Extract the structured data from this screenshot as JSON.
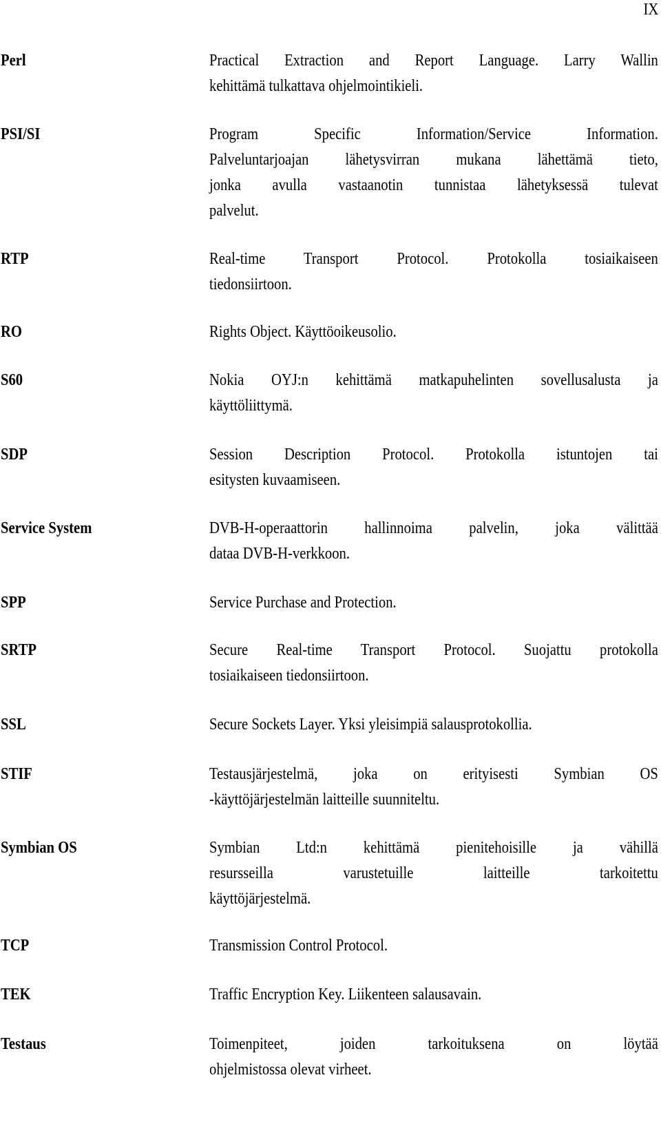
{
  "page": {
    "number": "IX"
  },
  "glossary": {
    "entries": [
      {
        "term": "Perl",
        "lines": [
          "Practical Extraction and Report Language. Larry Wallin",
          "kehittämä tulkattava ohjelmointikieli."
        ]
      },
      {
        "term": "PSI/SI",
        "lines": [
          "Program Specific Information/Service Information.",
          "Palveluntarjoajan lähetysvirran mukana lähettämä tieto,",
          "jonka avulla vastaanotin tunnistaa lähetyksessä tulevat",
          "palvelut."
        ]
      },
      {
        "term": "RTP",
        "lines": [
          "Real-time Transport Protocol. Protokolla tosiaikaiseen",
          "tiedonsiirtoon."
        ]
      },
      {
        "term": "RO",
        "lines": [
          "Rights Object. Käyttöoikeusolio."
        ]
      },
      {
        "term": "S60",
        "lines": [
          "Nokia OYJ:n kehittämä matkapuhelinten sovellusalusta ja",
          "käyttöliittymä."
        ]
      },
      {
        "term": "SDP",
        "lines": [
          "Session Description Protocol. Protokolla istuntojen tai",
          "esitysten kuvaamiseen."
        ]
      },
      {
        "term": "Service System",
        "lines": [
          "DVB-H-operaattorin hallinnoima palvelin, joka välittää",
          "dataa DVB-H-verkkoon."
        ]
      },
      {
        "term": "SPP",
        "lines": [
          "Service Purchase and Protection."
        ]
      },
      {
        "term": "SRTP",
        "lines": [
          "Secure Real-time Transport Protocol. Suojattu protokolla",
          "tosiaikaiseen tiedonsiirtoon."
        ]
      },
      {
        "term": "SSL",
        "lines": [
          "Secure Sockets Layer. Yksi yleisimpiä salausprotokollia."
        ]
      },
      {
        "term": "STIF",
        "lines": [
          "Testausjärjestelmä, joka on erityisesti Symbian OS",
          "-käyttöjärjestelmän laitteille suunniteltu."
        ]
      },
      {
        "term": "Symbian OS",
        "lines": [
          "Symbian Ltd:n kehittämä pienitehoisille ja vähillä",
          "resursseilla varustetuille laitteille tarkoitettu",
          "käyttöjärjestelmä."
        ]
      },
      {
        "term": "TCP",
        "lines": [
          "Transmission Control Protocol."
        ]
      },
      {
        "term": "TEK",
        "lines": [
          "Traffic Encryption Key. Liikenteen salausavain."
        ]
      },
      {
        "term": "Testaus",
        "lines": [
          "Toimenpiteet, joiden tarkoituksena on löytää",
          "ohjelmistossa olevat virheet."
        ]
      }
    ]
  }
}
